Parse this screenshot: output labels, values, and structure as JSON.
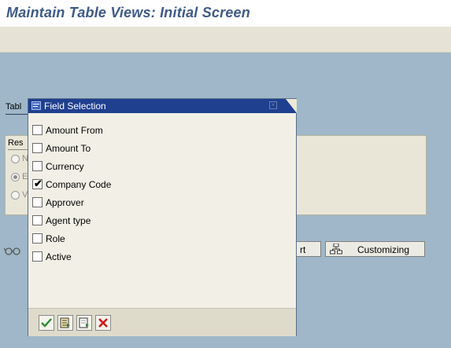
{
  "window": {
    "title": "Maintain Table Views: Initial Screen"
  },
  "background": {
    "table_label": "Tabl",
    "group_title": "Res",
    "radio_labels": [
      "N",
      "E",
      "V"
    ],
    "partial_button_label": "rt",
    "customizing_button_label": "Customizing"
  },
  "dialog": {
    "title": "Field Selection",
    "fields": [
      {
        "label": "Amount From",
        "checked": false
      },
      {
        "label": "Amount To",
        "checked": false
      },
      {
        "label": "Currency",
        "checked": false
      },
      {
        "label": "Company Code",
        "checked": true
      },
      {
        "label": "Approver",
        "checked": false
      },
      {
        "label": "Agent type",
        "checked": false
      },
      {
        "label": "Role",
        "checked": false
      },
      {
        "label": "Active",
        "checked": false
      }
    ],
    "footer_buttons": [
      "confirm",
      "select-all",
      "deselect-all",
      "cancel"
    ]
  },
  "colors": {
    "title_text": "#3e5a88",
    "dialog_titlebar": "#1f3f8f",
    "work_area": "#9fb7c8",
    "confirm_green": "#2e8b2e",
    "cancel_red": "#cc1f1f"
  }
}
